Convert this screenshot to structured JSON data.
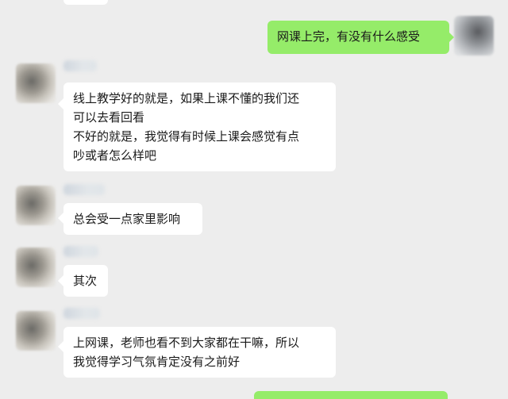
{
  "colors": {
    "background": "#ededed",
    "received_bubble": "#ffffff",
    "sent_bubble": "#95ec69"
  },
  "messages": [
    {
      "side": "right",
      "text": "网课上完，有没有什么感受"
    },
    {
      "side": "left",
      "text": "线上教学好的就是，如果上课不懂的我们还\n可以去看回看\n不好的就是，我觉得有时候上课会感觉有点\n吵或者怎么样吧"
    },
    {
      "side": "left",
      "text": "总会受一点家里影响"
    },
    {
      "side": "left",
      "text": "其次"
    },
    {
      "side": "left",
      "text": "上网课，老师也看不到大家都在干嘛，所以\n我觉得学习气氛肯定没有之前好"
    }
  ]
}
